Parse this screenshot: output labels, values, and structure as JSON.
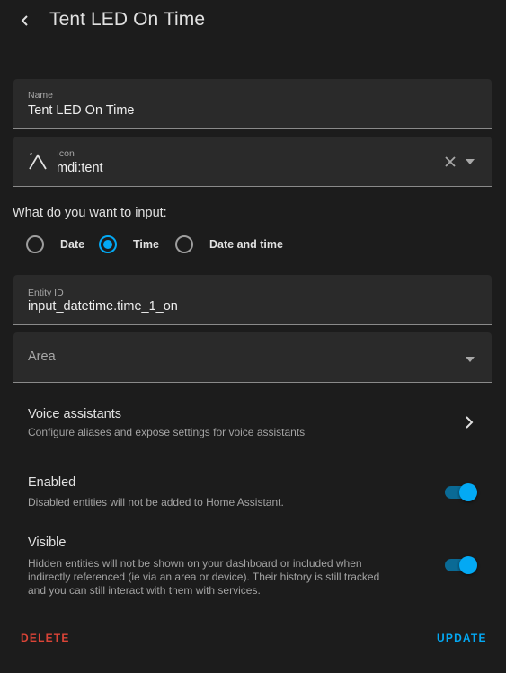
{
  "header": {
    "title": "Tent LED On Time"
  },
  "fields": {
    "name": {
      "label": "Name",
      "value": "Tent LED On Time"
    },
    "icon": {
      "label": "Icon",
      "value": "mdi:tent"
    },
    "entity_id": {
      "label": "Entity ID",
      "value": "input_datetime.time_1_on"
    },
    "area": {
      "placeholder": "Area"
    }
  },
  "input_type": {
    "question": "What do you want to input:",
    "options": [
      {
        "label": "Date",
        "checked": false
      },
      {
        "label": "Time",
        "checked": true
      },
      {
        "label": "Date and time",
        "checked": false
      }
    ]
  },
  "voice_assistants": {
    "title": "Voice assistants",
    "subtitle": "Configure aliases and expose settings for voice assistants"
  },
  "enabled": {
    "title": "Enabled",
    "subtitle": "Disabled entities will not be added to Home Assistant.",
    "on": true
  },
  "visible": {
    "title": "Visible",
    "subtitle_lines": [
      "Hidden entities will not be shown on your dashboard or included when",
      "indirectly referenced (ie via an area or device). Their history is still tracked",
      "and you can still interact with them with services."
    ],
    "on": true
  },
  "actions": {
    "delete": "DELETE",
    "update": "UPDATE"
  },
  "icons": [
    "back-arrow-icon",
    "tent-icon",
    "close-icon",
    "chevron-down-icon",
    "chevron-right-icon"
  ],
  "colors": {
    "accent": "#03a9f4",
    "danger": "#db4437",
    "background": "#1c1c1c",
    "field": "#2a2a2a"
  }
}
